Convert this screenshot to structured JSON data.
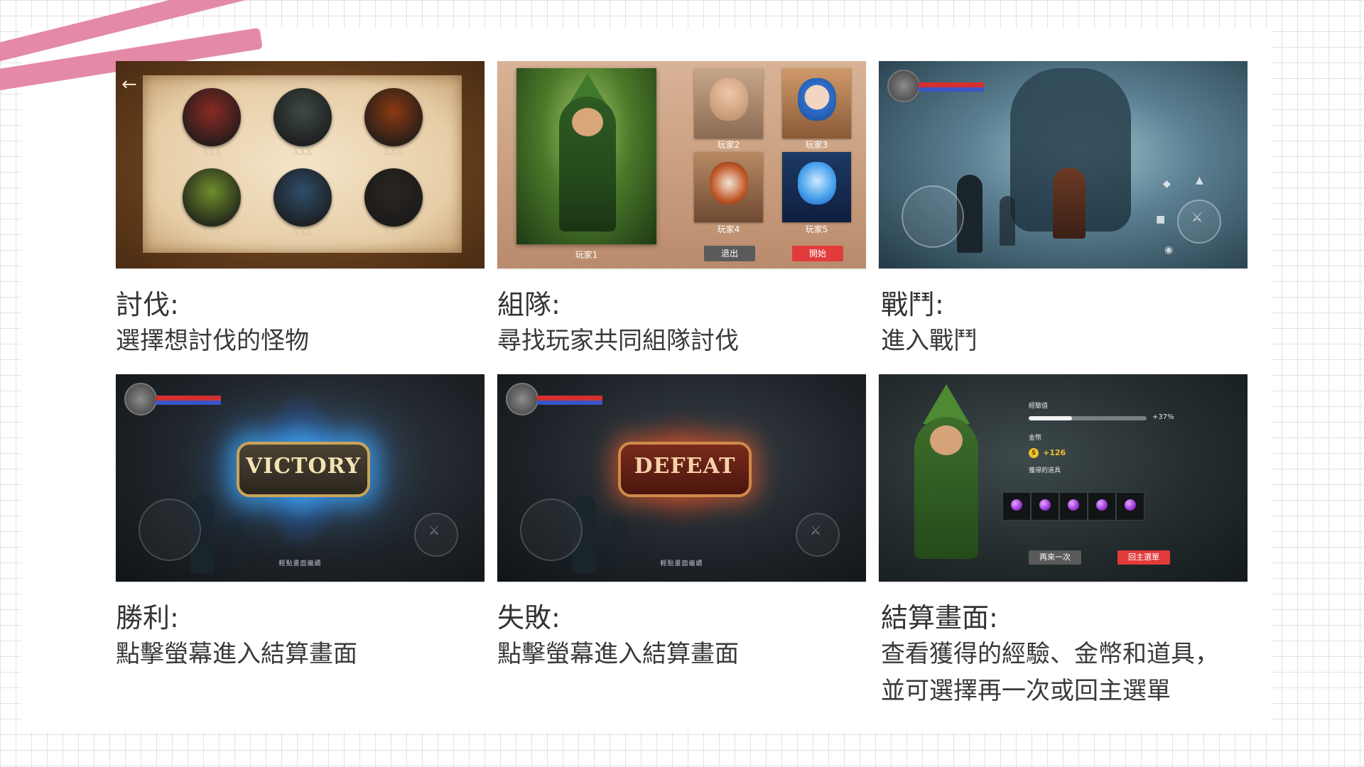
{
  "cards": [
    {
      "id": "hunt",
      "monsters": [
        "XXX",
        "XXX",
        "XXX",
        "XXX",
        "XXX",
        "XXX"
      ],
      "monster_colors": [
        "#8a2a24",
        "#3d4a46",
        "#8b3a12",
        "#6e8f2a",
        "#2f4d6a",
        "#2a2520"
      ],
      "back_icon": "back-arrow-icon",
      "caption_title": "討伐:",
      "caption_desc": [
        "選擇想討伐的怪物"
      ]
    },
    {
      "id": "team",
      "players": [
        "玩家1",
        "玩家2",
        "玩家3",
        "玩家4",
        "玩家5"
      ],
      "exit_label": "退出",
      "start_label": "開始",
      "caption_title": "組隊:",
      "caption_desc": [
        "尋找玩家共同組隊討伐"
      ]
    },
    {
      "id": "battle",
      "caption_title": "戰鬥:",
      "caption_desc": [
        "進入戰鬥"
      ]
    },
    {
      "id": "victory",
      "banner": "VICTORY",
      "tap_hint": "輕點畫面繼續",
      "caption_title": "勝利:",
      "caption_desc": [
        "點擊螢幕進入結算畫面"
      ]
    },
    {
      "id": "defeat",
      "banner": "DEFEAT",
      "tap_hint": "輕點畫面繼續",
      "caption_title": "失敗:",
      "caption_desc": [
        "點擊螢幕進入結算畫面"
      ]
    },
    {
      "id": "settlement",
      "xp_label": "經驗值",
      "xp_percent": "+37%",
      "xp_fill": 0.37,
      "gold_label": "金幣",
      "gold_icon": "$",
      "gold_value": "+126",
      "items_label": "獲得的道具",
      "item_count": 5,
      "again_label": "再來一次",
      "menu_label": "回主選單",
      "caption_title": "結算畫面:",
      "caption_desc": [
        "查看獲得的經驗、金幣和道具，",
        "並可選擇再一次或回主選單"
      ]
    }
  ],
  "colors": {
    "accent_red": "#e23b3b",
    "button_gray": "#5a5a5a",
    "decor_pink": "#e48aa7",
    "gold": "#f0c22b"
  }
}
